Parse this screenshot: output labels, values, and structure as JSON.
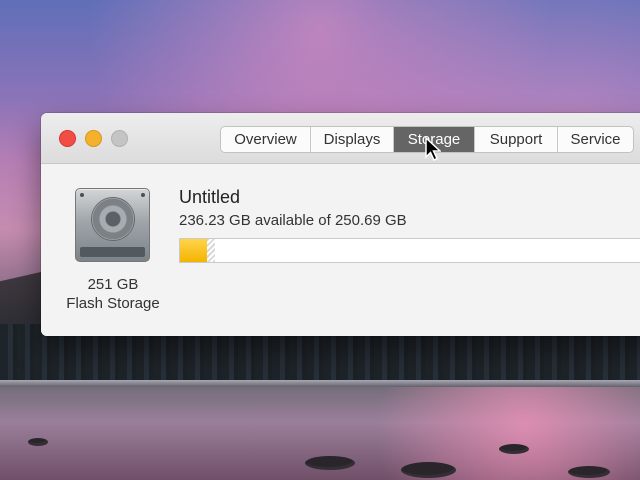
{
  "window": {
    "tabs": [
      {
        "label": "Overview",
        "active": false
      },
      {
        "label": "Displays",
        "active": false
      },
      {
        "label": "Storage",
        "active": true
      },
      {
        "label": "Support",
        "active": false
      },
      {
        "label": "Service",
        "active": false
      }
    ]
  },
  "disk": {
    "capacity_label": "251 GB",
    "type_label": "Flash Storage",
    "icon": "hard-drive-icon"
  },
  "volume": {
    "name": "Untitled",
    "availability_text": "236.23 GB available of 250.69 GB",
    "used_fraction": 0.058
  },
  "colors": {
    "close": "#f24d45",
    "minimize": "#f4b12b",
    "zoom": "#c4c4c4",
    "active_tab": "#656565",
    "storage_used": "#f4b400"
  },
  "icons": {
    "close": "close-button",
    "minimize": "minimize-button",
    "zoom": "zoom-button",
    "cursor": "mouse-pointer"
  }
}
